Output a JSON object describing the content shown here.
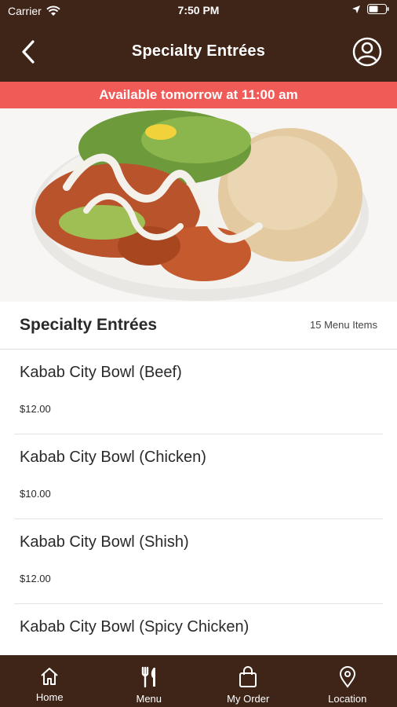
{
  "status_bar": {
    "carrier": "Carrier",
    "time": "7:50 PM"
  },
  "nav": {
    "title": "Specialty Entrées"
  },
  "banner": {
    "text": "Available tomorrow at 11:00 am"
  },
  "section": {
    "name": "Specialty Entrées",
    "count": "15 Menu Items"
  },
  "items": [
    {
      "name": "Kabab City Bowl (Beef)",
      "price": "$12.00"
    },
    {
      "name": "Kabab City Bowl (Chicken)",
      "price": "$10.00"
    },
    {
      "name": "Kabab City Bowl (Shish)",
      "price": "$12.00"
    },
    {
      "name": "Kabab City Bowl (Spicy Chicken)",
      "price": ""
    }
  ],
  "tabs": [
    {
      "label": "Home",
      "icon": "home-icon"
    },
    {
      "label": "Menu",
      "icon": "fork-knife-icon"
    },
    {
      "label": "My Order",
      "icon": "shopping-bag-icon"
    },
    {
      "label": "Location",
      "icon": "location-pin-icon"
    }
  ],
  "colors": {
    "header_bg": "#3f2418",
    "banner_bg": "#f05a57",
    "text": "#2a2a2a"
  }
}
